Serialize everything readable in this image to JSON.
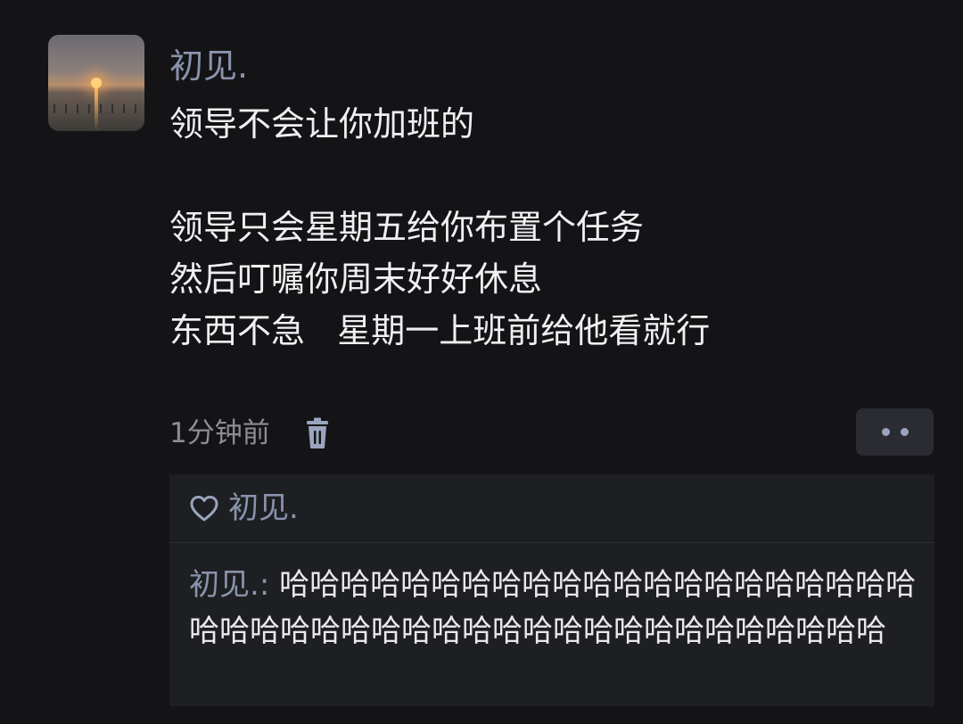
{
  "post": {
    "author": "初见.",
    "lines": [
      "领导不会让你加班的",
      "",
      "领导只会星期五给你布置个任务",
      "然后叮嘱你周末好好休息",
      "东西不急   星期一上班前给他看就行"
    ],
    "time": "1分钟前"
  },
  "likes": {
    "names": "初见."
  },
  "comment": {
    "author": "初见.",
    "separator": ": ",
    "text": "哈哈哈哈哈哈哈哈哈哈哈哈哈哈哈哈哈哈哈哈哈哈哈哈哈哈哈哈哈哈哈哈哈哈哈哈哈哈哈哈哈哈哈哈"
  },
  "icons": [
    "trash-icon",
    "more-icon",
    "heart-icon"
  ],
  "colors": {
    "background": "#141416",
    "name": "#8a93ad",
    "text": "#f0f0f2",
    "muted": "#8d8d92",
    "panel": "#1e1f22"
  }
}
